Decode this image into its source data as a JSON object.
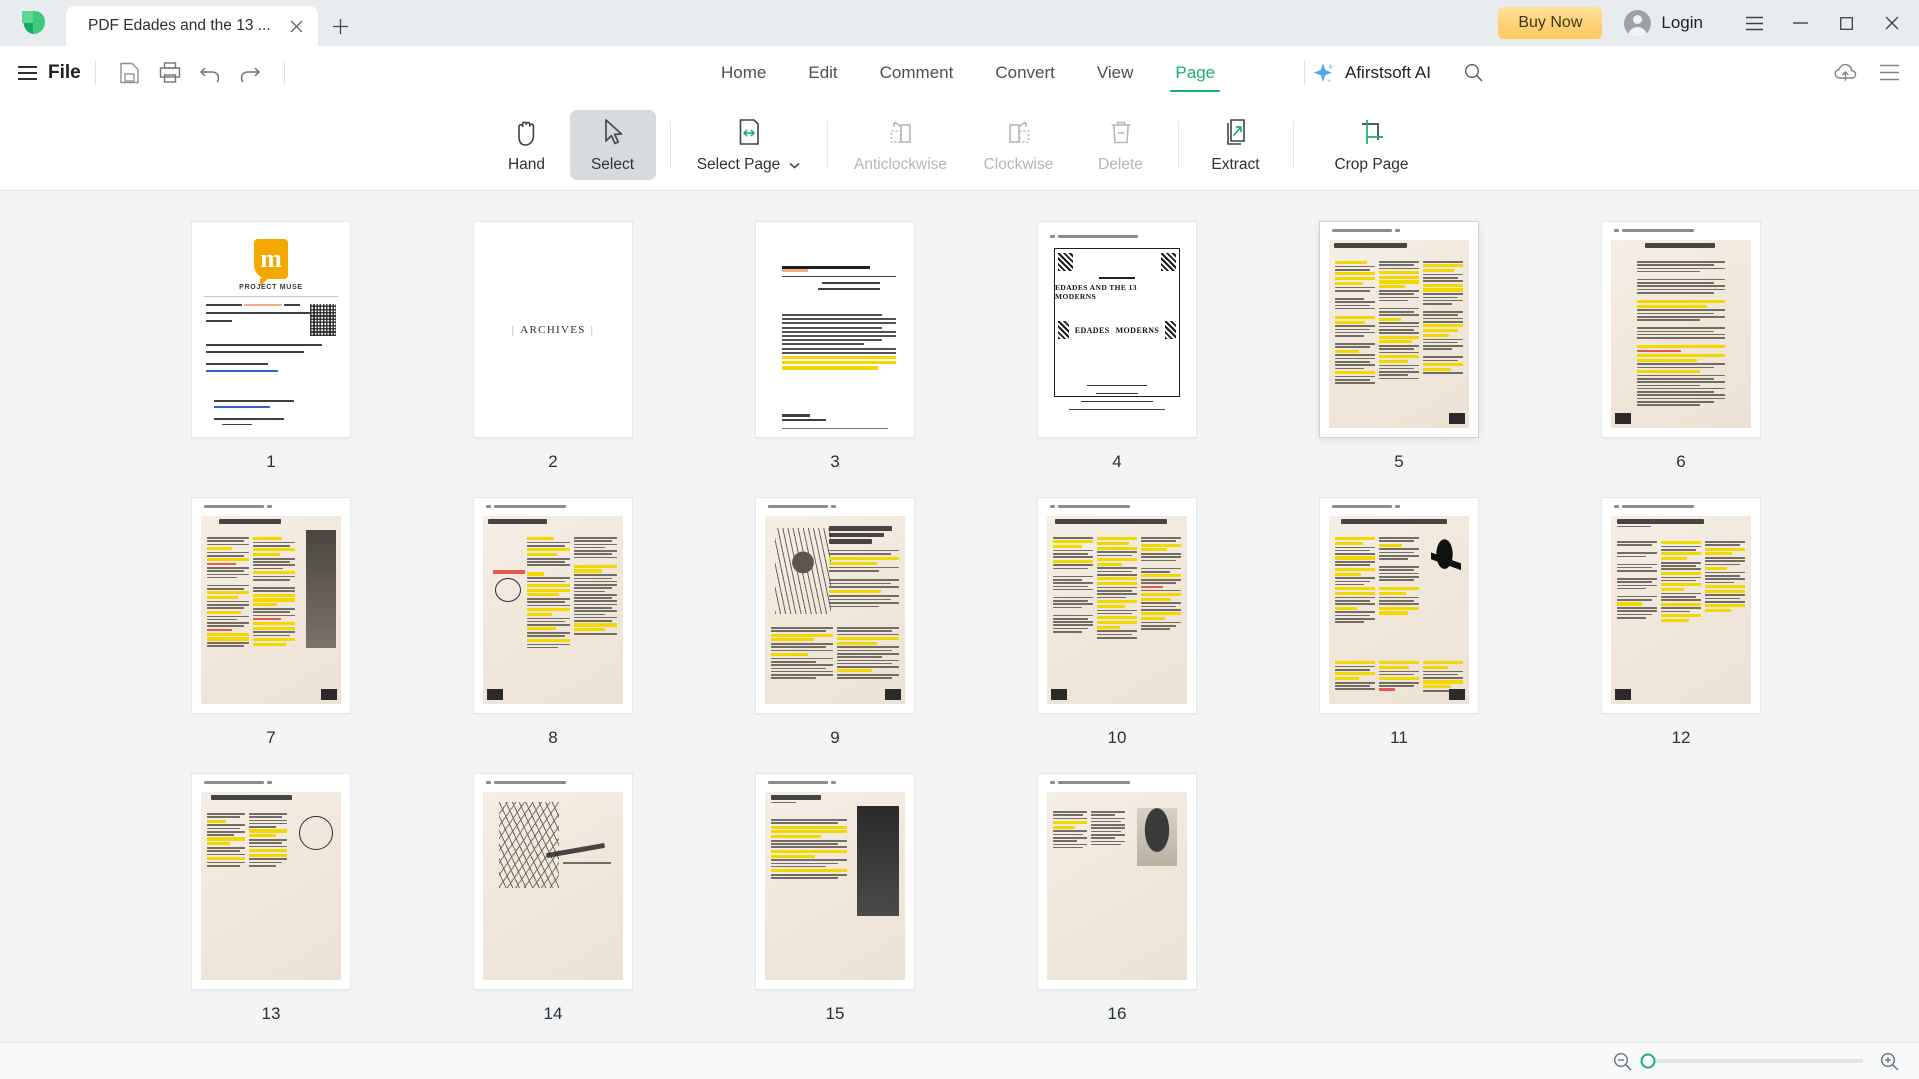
{
  "app": {
    "logo_icon": "afirstsoft-leaf-logo"
  },
  "titlebar": {
    "tab_title": "PDF Edades and the 13 ...",
    "close_tab_icon": "close-icon",
    "new_tab_icon": "plus-icon",
    "buy_now_label": "Buy Now",
    "login_label": "Login",
    "menu_icon": "hamburger-menu-icon",
    "minimize_icon": "minimize-icon",
    "maximize_icon": "maximize-icon",
    "close_icon": "close-icon"
  },
  "menubar": {
    "file_label": "File",
    "save_icon": "save-document-icon",
    "print_icon": "print-icon",
    "undo_icon": "undo-icon",
    "redo_icon": "redo-icon",
    "tabs": [
      {
        "label": "Home",
        "active": false
      },
      {
        "label": "Edit",
        "active": false
      },
      {
        "label": "Comment",
        "active": false
      },
      {
        "label": "Convert",
        "active": false
      },
      {
        "label": "View",
        "active": false
      },
      {
        "label": "Page",
        "active": true
      }
    ],
    "ai_label": "Afirstsoft AI",
    "ai_icon": "sparkle-icon",
    "search_icon": "search-icon",
    "cloud_icon": "cloud-upload-icon",
    "panel_icon": "collapse-panel-icon"
  },
  "ribbon": {
    "tools": [
      {
        "label": "Hand",
        "icon": "hand-icon",
        "state": "normal"
      },
      {
        "label": "Select",
        "icon": "cursor-arrow-icon",
        "state": "selected"
      },
      {
        "label": "Select Page",
        "icon": "select-page-icon",
        "state": "normal",
        "has_dropdown": true
      },
      {
        "label": "Anticlockwise",
        "icon": "rotate-left-icon",
        "state": "disabled"
      },
      {
        "label": "Clockwise",
        "icon": "rotate-right-icon",
        "state": "disabled"
      },
      {
        "label": "Delete",
        "icon": "trash-icon",
        "state": "disabled"
      },
      {
        "label": "Extract",
        "icon": "extract-pages-icon",
        "state": "normal"
      },
      {
        "label": "Crop Page",
        "icon": "crop-icon",
        "state": "normal"
      }
    ]
  },
  "hover_toolbar": {
    "on_page": 5,
    "buttons": [
      {
        "icon": "rotate-left-icon",
        "name": "rotate-anticlockwise"
      },
      {
        "icon": "rotate-right-icon",
        "name": "rotate-clockwise"
      },
      {
        "icon": "trash-icon",
        "name": "delete-page"
      }
    ]
  },
  "thumbnails": [
    {
      "number": "1",
      "kind": "cover",
      "title": "PROJECT MUSE"
    },
    {
      "number": "2",
      "kind": "archives",
      "title": "ARCHIVES"
    },
    {
      "number": "3",
      "kind": "article",
      "title": "Edades and the 13 Moderns (1928)"
    },
    {
      "number": "4",
      "kind": "plate",
      "title": "EDADES AND THE 13 MODERNS"
    },
    {
      "number": "5",
      "kind": "scan3col",
      "title": "DISTORTION IN ART"
    },
    {
      "number": "6",
      "kind": "scan2col",
      "title": "DISTORTION IN ART"
    },
    {
      "number": "7",
      "kind": "scanfig",
      "title": "DISTORTION IN ART"
    },
    {
      "number": "8",
      "kind": "scan3col",
      "title": "DISTORTION IN ART"
    },
    {
      "number": "9",
      "kind": "scanfig",
      "title": "LIBERATING OURSELVES FROM ACADEMISM"
    },
    {
      "number": "10",
      "kind": "scan3col",
      "title": "LIBERATING OURSELVES FROM ACADEMISM"
    },
    {
      "number": "11",
      "kind": "scanfig",
      "title": "LIBERATING OURSELVES FROM ACADEMISM"
    },
    {
      "number": "12",
      "kind": "scan3col",
      "title": "TOWARDS VIRILITY IN ART"
    },
    {
      "number": "13",
      "kind": "scanfig",
      "title": "TOWARDS VIRILITY IN ART"
    },
    {
      "number": "14",
      "kind": "scanfig",
      "title": "MODERN ART"
    },
    {
      "number": "15",
      "kind": "scanfig",
      "title": "MODERN ART"
    },
    {
      "number": "16",
      "kind": "scanfig",
      "title": ""
    }
  ],
  "bottombar": {
    "zoom_out_icon": "zoom-out-icon",
    "zoom_in_icon": "zoom-in-icon",
    "zoom_value": 0
  },
  "colors": {
    "accent_green": "#17b26a",
    "buy_now": "#ffd173",
    "highlight_yellow": "#f2d800",
    "highlight_red": "#e03a2f",
    "titlebar_bg": "#e9ecef",
    "workarea_bg": "#f2f4f6"
  }
}
